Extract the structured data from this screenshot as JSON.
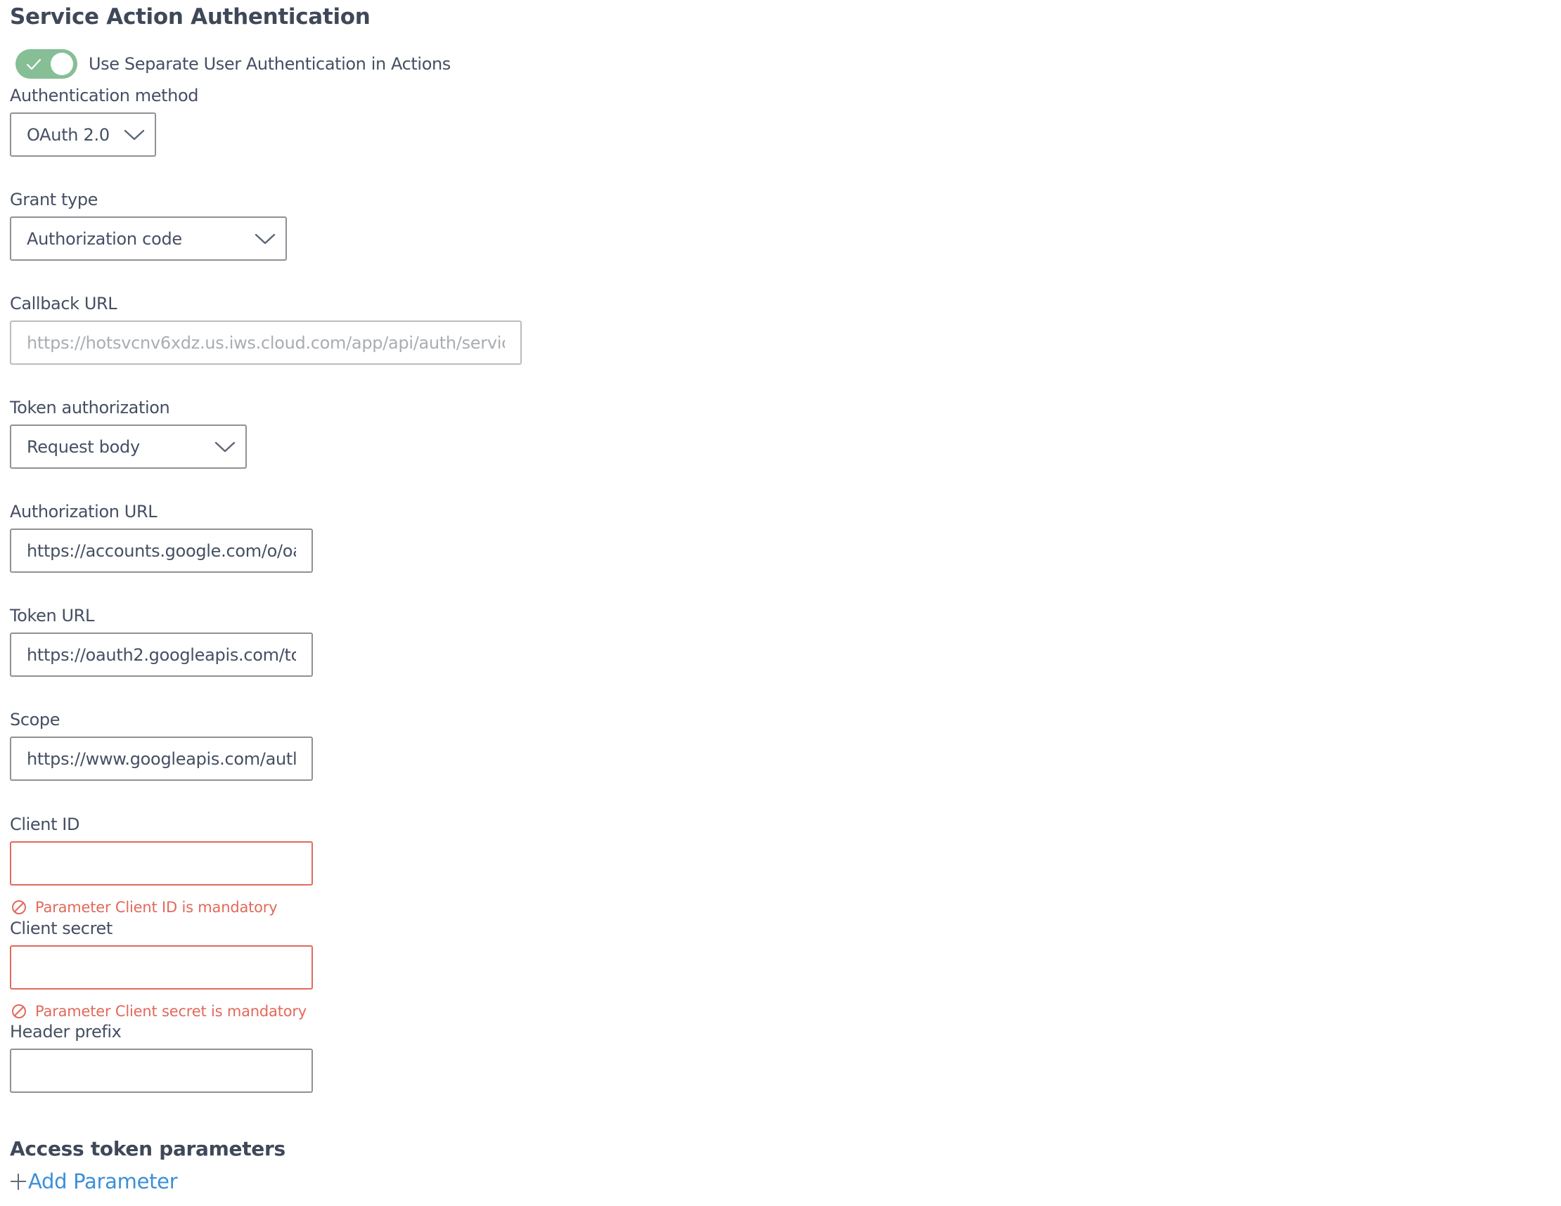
{
  "page": {
    "title": "Service Action Authentication"
  },
  "toggle": {
    "label": "Use Separate User Authentication in Actions",
    "checked": true,
    "color": "#86be96"
  },
  "fields": {
    "auth_method": {
      "label": "Authentication method",
      "value": "OAuth 2.0"
    },
    "grant_type": {
      "label": "Grant type",
      "value": "Authorization code"
    },
    "callback_url": {
      "label": "Callback URL",
      "placeholder": "https://hotsvcnv6xdz.us.iws.cloud.com/app/api/auth/servic"
    },
    "token_authorization": {
      "label": "Token authorization",
      "value": "Request body"
    },
    "authorization_url": {
      "label": "Authorization URL",
      "value": "https://accounts.google.com/o/oa"
    },
    "token_url": {
      "label": "Token URL",
      "value": "https://oauth2.googleapis.com/tc"
    },
    "scope": {
      "label": "Scope",
      "value": "https://www.googleapis.com/autl"
    },
    "client_id": {
      "label": "Client ID",
      "value": "",
      "error": "Parameter Client ID is mandatory"
    },
    "client_secret": {
      "label": "Client secret",
      "value": "",
      "error": "Parameter Client secret is mandatory"
    },
    "header_prefix": {
      "label": "Header prefix",
      "value": ""
    }
  },
  "access_token": {
    "heading": "Access token parameters",
    "add_label": "Add Parameter"
  },
  "colors": {
    "error": "#e2695a",
    "link": "#3b8fd8",
    "text": "#454f63",
    "border": "#8e9196"
  },
  "icons": {
    "toggle_check": "check-icon",
    "select_chevron": "chevron-down-icon",
    "error": "prohibited-icon",
    "add": "plus-icon"
  }
}
